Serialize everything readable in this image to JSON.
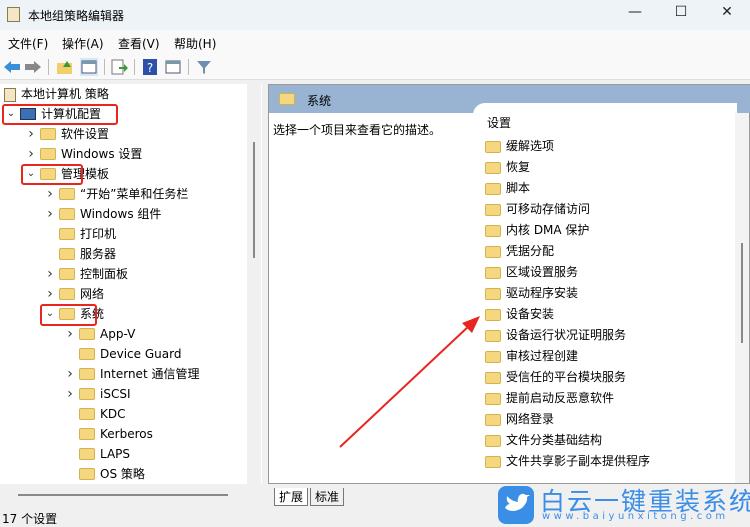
{
  "window": {
    "title": "本地组策略编辑器",
    "minimize": "—",
    "maximize": "☐",
    "close": "✕"
  },
  "menu": [
    "文件(F)",
    "操作(A)",
    "查看(V)",
    "帮助(H)"
  ],
  "toolbar_icons": [
    "back-arrow-icon",
    "forward-arrow-icon",
    "up-folder-icon",
    "show-hide-tree-icon",
    "export-list-icon",
    "help-icon",
    "properties-icon",
    "filter-icon"
  ],
  "tree": {
    "root": "本地计算机 策略",
    "items": [
      {
        "label": "计算机配置",
        "level": 1,
        "expanded": true
      },
      {
        "label": "软件设置",
        "level": 2,
        "chev": ">"
      },
      {
        "label": "Windows 设置",
        "level": 2,
        "chev": ">"
      },
      {
        "label": "管理模板",
        "level": 2,
        "chev": "v"
      },
      {
        "label": "“开始”菜单和任务栏",
        "level": 3,
        "chev": ">"
      },
      {
        "label": "Windows 组件",
        "level": 3,
        "chev": ">"
      },
      {
        "label": "打印机",
        "level": 3,
        "chev": ""
      },
      {
        "label": "服务器",
        "level": 3,
        "chev": ""
      },
      {
        "label": "控制面板",
        "level": 3,
        "chev": ">"
      },
      {
        "label": "网络",
        "level": 3,
        "chev": ">"
      },
      {
        "label": "系统",
        "level": 3,
        "chev": "v"
      },
      {
        "label": "App-V",
        "level": 4,
        "chev": ">"
      },
      {
        "label": "Device Guard",
        "level": 4,
        "chev": ""
      },
      {
        "label": "Internet 通信管理",
        "level": 4,
        "chev": ">"
      },
      {
        "label": "iSCSI",
        "level": 4,
        "chev": ">"
      },
      {
        "label": "KDC",
        "level": 4,
        "chev": ""
      },
      {
        "label": "Kerberos",
        "level": 4,
        "chev": ""
      },
      {
        "label": "LAPS",
        "level": 4,
        "chev": ""
      },
      {
        "label": "OS 策略",
        "level": 4,
        "chev": ""
      }
    ]
  },
  "right": {
    "header": "系统",
    "description": "选择一个项目来查看它的描述。",
    "column": "设置",
    "items": [
      "缓解选项",
      "恢复",
      "脚本",
      "可移动存储访问",
      "内核 DMA 保护",
      "凭据分配",
      "区域设置服务",
      "驱动程序安装",
      "设备安装",
      "设备运行状况证明服务",
      "审核过程创建",
      "受信任的平台模块服务",
      "提前启动反恶意软件",
      "网络登录",
      "文件分类基础结构",
      "文件共享影子副本提供程序"
    ]
  },
  "tabs": [
    "扩展",
    "标准"
  ],
  "status": "17 个设置",
  "watermark": {
    "name": "白云一键重装系统",
    "url": "www.baiyunxitong.com"
  },
  "colors": {
    "highlight": "#e8261f",
    "header": "#98b4d2",
    "logo": "#3a8ee6"
  }
}
